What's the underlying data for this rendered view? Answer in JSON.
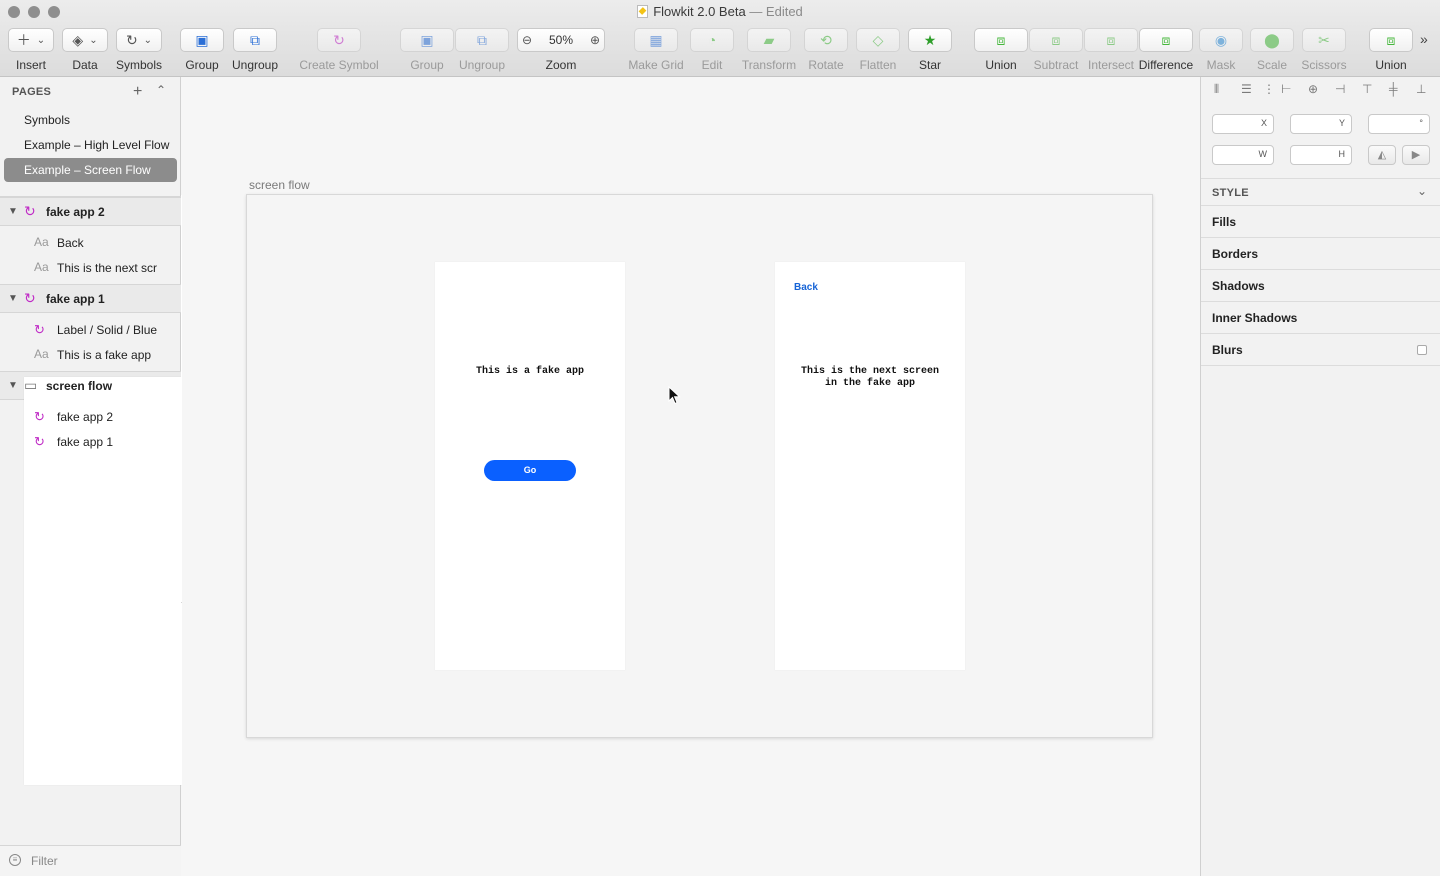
{
  "window": {
    "title": "Flowkit 2.0 Beta",
    "edited": "— Edited"
  },
  "toolbar": {
    "items": [
      {
        "label": "Insert",
        "icon": "plus-icon"
      },
      {
        "label": "Data",
        "icon": "layers-stack-icon"
      },
      {
        "label": "Symbols",
        "icon": "symbol-icon"
      },
      {
        "label": "Group",
        "icon": "group-icon"
      },
      {
        "label": "Ungroup",
        "icon": "ungroup-icon"
      },
      {
        "label": "Create Symbol",
        "icon": "create-symbol-icon"
      },
      {
        "label": "Group",
        "icon": "group-icon"
      },
      {
        "label": "Ungroup",
        "icon": "ungroup-icon"
      },
      {
        "label": "Zoom",
        "icon": "zoom-icon"
      },
      {
        "label": "Make Grid",
        "icon": "grid-icon"
      },
      {
        "label": "Edit",
        "icon": "edit-icon"
      },
      {
        "label": "Transform",
        "icon": "transform-icon"
      },
      {
        "label": "Rotate",
        "icon": "rotate-icon"
      },
      {
        "label": "Flatten",
        "icon": "flatten-icon"
      },
      {
        "label": "Star",
        "icon": "star-icon"
      },
      {
        "label": "Union",
        "icon": "union-icon"
      },
      {
        "label": "Subtract",
        "icon": "subtract-icon"
      },
      {
        "label": "Intersect",
        "icon": "intersect-icon"
      },
      {
        "label": "Difference",
        "icon": "difference-icon"
      },
      {
        "label": "Mask",
        "icon": "mask-icon"
      },
      {
        "label": "Scale",
        "icon": "scale-icon"
      },
      {
        "label": "Scissors",
        "icon": "scissors-icon"
      },
      {
        "label": "Union",
        "icon": "union-icon"
      }
    ],
    "zoom_value": "50%",
    "overflow_icon": "chevrons-right-icon"
  },
  "pages": {
    "header": "PAGES",
    "items": [
      {
        "label": "Symbols"
      },
      {
        "label": "Example – High Level Flow"
      },
      {
        "label": "Example – Screen Flow",
        "selected": true
      }
    ]
  },
  "layers": {
    "groups": [
      {
        "name": "fake app 2",
        "icon": "symbol-icon",
        "children": [
          {
            "name": "Back",
            "icon": "text-icon"
          },
          {
            "name": "This is the next scr",
            "icon": "text-icon"
          }
        ]
      },
      {
        "name": "fake app 1",
        "icon": "symbol-icon",
        "children": [
          {
            "name": "Label / Solid / Blue",
            "icon": "symbol-icon"
          },
          {
            "name": "This is a fake app",
            "icon": "text-icon"
          }
        ]
      },
      {
        "name": "screen flow",
        "icon": "artboard-icon",
        "children": [
          {
            "name": "fake app 2",
            "icon": "symbol-icon"
          },
          {
            "name": "fake app 1",
            "icon": "symbol-icon"
          }
        ]
      }
    ]
  },
  "filter": {
    "placeholder": "Filter"
  },
  "canvas": {
    "artboard_label": "screen flow",
    "screen1": {
      "text": "This is a fake app",
      "button_label": "Go"
    },
    "screen2": {
      "back_label": "Back",
      "text_line1": "This is the next screen",
      "text_line2": "in the fake app"
    }
  },
  "inspector": {
    "fields": {
      "x": "X",
      "y": "Y",
      "rotation": "°",
      "w": "W",
      "h": "H"
    },
    "style_header": "STYLE",
    "style_rows": [
      "Fills",
      "Borders",
      "Shadows",
      "Inner Shadows",
      "Blurs"
    ]
  },
  "colors": {
    "accent_blue": "#0a60ff",
    "symbol_purple": "#c02bc6",
    "selection_gray": "#8c8c8c"
  }
}
